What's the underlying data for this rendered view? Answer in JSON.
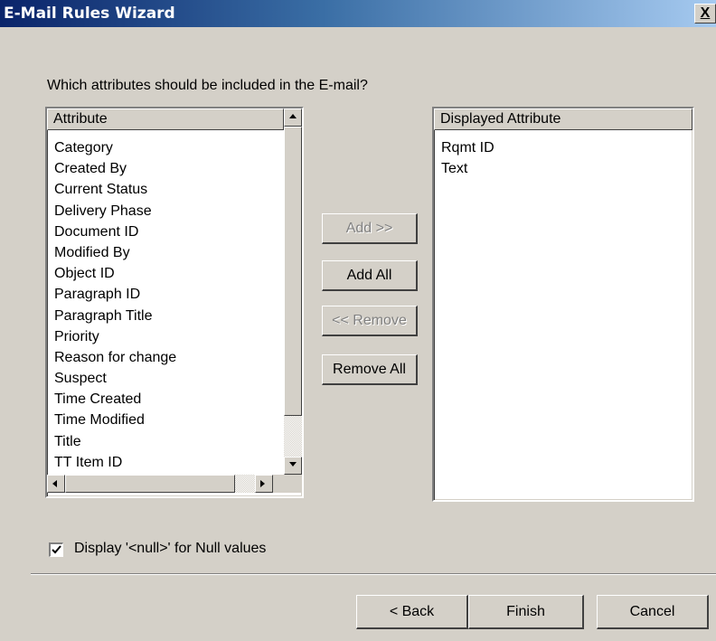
{
  "window": {
    "title": "E-Mail Rules Wizard",
    "close_glyph": "X"
  },
  "prompt": "Which attributes should be included in the E-mail?",
  "available": {
    "header": "Attribute",
    "items": [
      "Category",
      "Created By",
      "Current Status",
      "Delivery Phase",
      "Document ID",
      "Modified By",
      "Object ID",
      "Paragraph ID",
      "Paragraph Title",
      "Priority",
      "Reason for change",
      "Suspect",
      "Time Created",
      "Time Modified",
      "Title",
      "TT Item ID"
    ]
  },
  "displayed": {
    "header": "Displayed Attribute",
    "items": [
      "Rqmt ID",
      "Text"
    ]
  },
  "actions": {
    "add": "Add >>",
    "add_all": "Add All",
    "remove": "<< Remove",
    "remove_all": "Remove All"
  },
  "null_option": {
    "label": "Display '<null>' for Null values",
    "checked": true
  },
  "footer": {
    "back": "< Back",
    "finish": "Finish",
    "cancel": "Cancel"
  },
  "colors": {
    "title_start": "#0a246a",
    "title_end": "#a6caf0",
    "face": "#d4d0c8"
  }
}
